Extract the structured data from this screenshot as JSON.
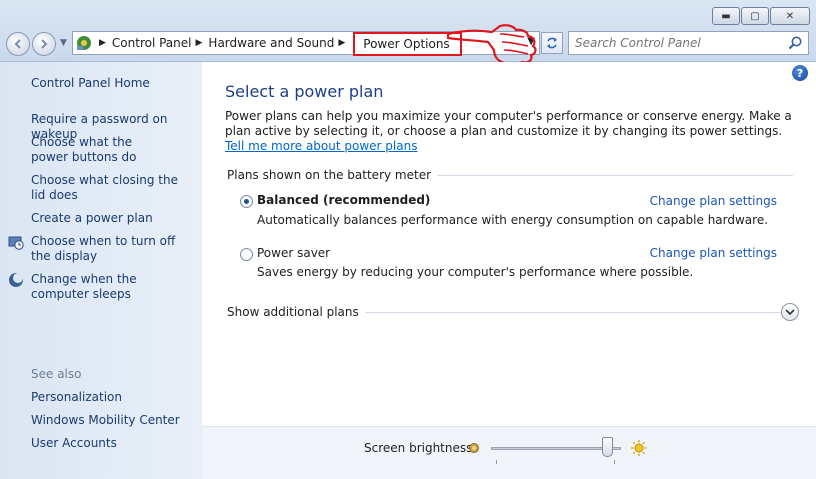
{
  "window": {
    "minimize_glyph": "▬",
    "maximize_glyph": "▢",
    "close_glyph": "✕"
  },
  "address": {
    "crumbs": [
      "Control Panel",
      "Hardware and Sound",
      "Power Options"
    ],
    "icon": "control-panel-icon"
  },
  "search": {
    "placeholder": "Search Control Panel"
  },
  "sidebar": {
    "home": "Control Panel Home",
    "links": [
      "Require a password on wakeup",
      "Choose what the power buttons do",
      "Choose what closing the lid does",
      "Create a power plan",
      "Choose when to turn off the display",
      "Change when the computer sleeps"
    ],
    "see_also_heading": "See also",
    "see_also": [
      "Personalization",
      "Windows Mobility Center",
      "User Accounts"
    ]
  },
  "main": {
    "help_glyph": "?",
    "title": "Select a power plan",
    "intro_text": "Power plans can help you maximize your computer's performance or conserve energy. Make a plan active by selecting it, or choose a plan and customize it by changing its power settings.",
    "intro_link": "Tell me more about power plans",
    "section_heading": "Plans shown on the battery meter",
    "plans": [
      {
        "name": "Balanced (recommended)",
        "description": "Automatically balances performance with energy consumption on capable hardware.",
        "link": "Change plan settings",
        "selected": true
      },
      {
        "name": "Power saver",
        "description": "Saves energy by reducing your computer's performance where possible.",
        "link": "Change plan settings",
        "selected": false
      }
    ],
    "additional_plans": "Show additional plans",
    "brightness_label": "Screen brightness:",
    "brightness_level": 0.9
  },
  "colors": {
    "accent_link": "#1a56b8",
    "title": "#1c3f88",
    "annotation_red": "#e0161d"
  }
}
